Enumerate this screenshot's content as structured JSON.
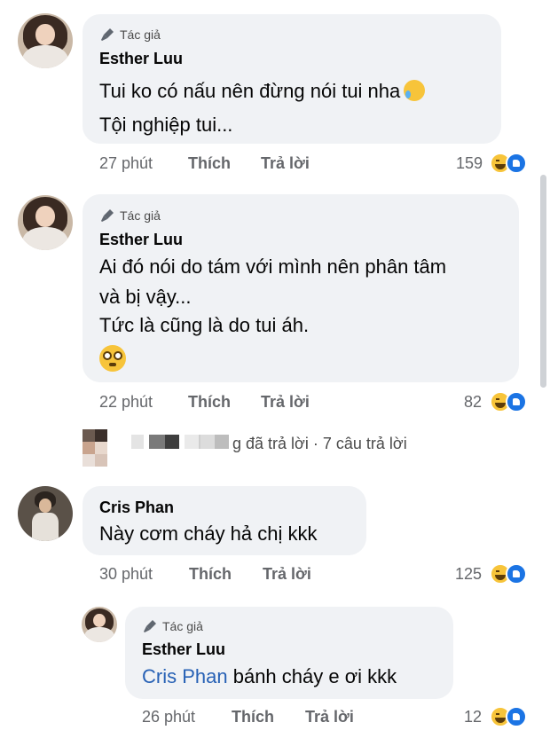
{
  "colors": {
    "bubble_bg": "#f0f2f5",
    "meta_text": "#65676b",
    "mention_blue": "#2761b5",
    "like_blue": "#1b74e4",
    "haha_yellow": "#f7c43a"
  },
  "icons": {
    "author_badge": "microphone-icon",
    "reaction_haha": "haha-reaction-icon",
    "reaction_like": "like-reaction-icon",
    "emoji_flushed": "flushed-face-emoji",
    "emoji_crying": "crying-face-emoji"
  },
  "comments": [
    {
      "badge": "Tác giả",
      "author": "Esther Luu",
      "lines": [
        "Tui ko có nấu nên đừng nói tui nha",
        "Tội nghiệp tui..."
      ],
      "time": "27 phút",
      "like_label": "Thích",
      "reply_label": "Trả lời",
      "reaction_count": "159"
    },
    {
      "badge": "Tác giả",
      "author": "Esther Luu",
      "lines": [
        "Ai đó nói do tám với mình nên phân tâm",
        "và bị vậy...",
        "Tức là cũng là do tui áh."
      ],
      "time": "22 phút",
      "like_label": "Thích",
      "reply_label": "Trả lời",
      "reaction_count": "82"
    },
    {
      "author": "Cris Phan",
      "lines": [
        "Này cơm cháy hả chị kkk"
      ],
      "time": "30 phút",
      "like_label": "Thích",
      "reply_label": "Trả lời",
      "reaction_count": "125"
    },
    {
      "badge": "Tác giả",
      "author": "Esther Luu",
      "mention": "Cris Phan",
      "text_after_mention": "bánh cháy e ơi kkk",
      "time": "26 phút",
      "like_label": "Thích",
      "reply_label": "Trả lời",
      "reaction_count": "12"
    }
  ],
  "replies_summary": {
    "name_fragment": "g",
    "text": "đã trả lời · 7 câu trả lời"
  }
}
